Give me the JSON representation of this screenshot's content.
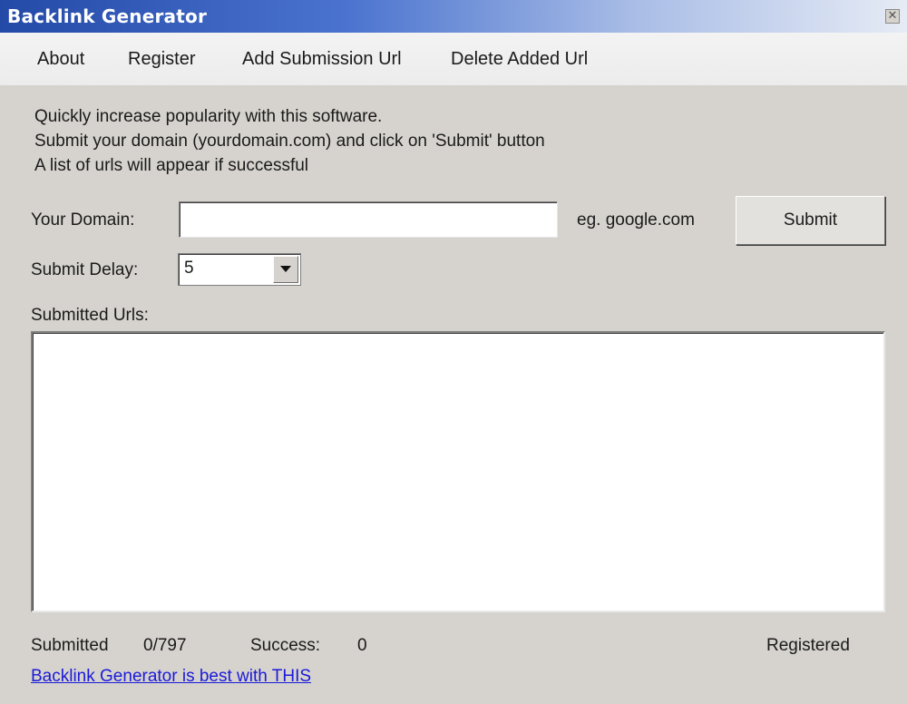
{
  "window": {
    "title": "Backlink Generator",
    "close_glyph": "✕"
  },
  "menu": {
    "items": [
      "About",
      "Register",
      "Add Submission Url",
      "Delete Added Url"
    ]
  },
  "description": {
    "lines": [
      "Quickly increase popularity with this software.",
      "Submit your domain (yourdomain.com) and click on 'Submit' button",
      "A list of urls will appear if successful"
    ]
  },
  "form": {
    "domain_label": "Your Domain:",
    "domain_value": "",
    "domain_hint": "eg. google.com",
    "submit_label": "Submit",
    "delay_label": "Submit Delay:",
    "delay_value": "5",
    "submitted_urls_label": "Submitted Urls:",
    "submitted_urls": []
  },
  "status": {
    "submitted_label": "Submitted",
    "submitted_value": "0/797",
    "success_label": "Success:",
    "success_value": "0",
    "registration": "Registered"
  },
  "footer": {
    "link_text": "Backlink Generator is best with THIS"
  },
  "colors": {
    "window_bg": "#d6d3ce",
    "titlebar_start": "#244aa8",
    "link": "#1a1ad8"
  }
}
